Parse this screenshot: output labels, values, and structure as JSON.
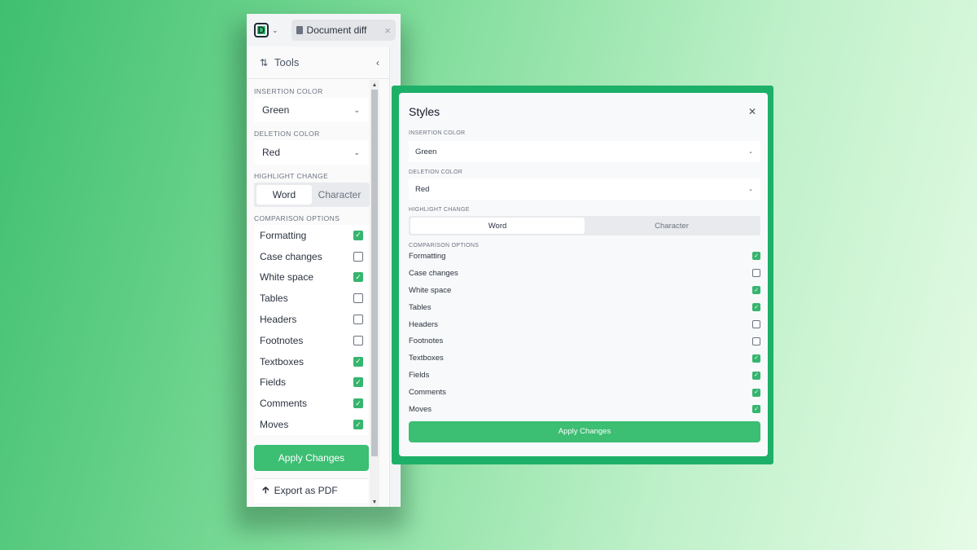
{
  "app": {
    "logo_letter": "D",
    "tab_title": "Document diff"
  },
  "tools": {
    "label": "Tools"
  },
  "insertion": {
    "label": "INSERTION COLOR",
    "value": "Green"
  },
  "deletion": {
    "label": "DELETION COLOR",
    "value": "Red"
  },
  "highlight": {
    "label": "HIGHLIGHT CHANGE",
    "options": [
      "Word",
      "Character"
    ],
    "selected": "Word"
  },
  "comparison": {
    "label": "COMPARISON OPTIONS",
    "items": [
      {
        "label": "Formatting",
        "checked": true
      },
      {
        "label": "Case changes",
        "checked": false
      },
      {
        "label": "White space",
        "checked": true
      },
      {
        "label": "Tables",
        "checked": false
      },
      {
        "label": "Headers",
        "checked": false
      },
      {
        "label": "Footnotes",
        "checked": false
      },
      {
        "label": "Textboxes",
        "checked": true
      },
      {
        "label": "Fields",
        "checked": true
      },
      {
        "label": "Comments",
        "checked": true
      },
      {
        "label": "Moves",
        "checked": true
      }
    ]
  },
  "dialog_comparison": {
    "items": [
      {
        "label": "Formatting",
        "checked": true
      },
      {
        "label": "Case changes",
        "checked": false
      },
      {
        "label": "White space",
        "checked": true
      },
      {
        "label": "Tables",
        "checked": true
      },
      {
        "label": "Headers",
        "checked": false
      },
      {
        "label": "Footnotes",
        "checked": false
      },
      {
        "label": "Textboxes",
        "checked": true
      },
      {
        "label": "Fields",
        "checked": true
      },
      {
        "label": "Comments",
        "checked": true
      },
      {
        "label": "Moves",
        "checked": true
      }
    ]
  },
  "apply_label": "Apply Changes",
  "export_label": "Export as PDF",
  "dialog": {
    "title": "Styles"
  },
  "colors": {
    "accent": "#3cbe73",
    "frame": "#1db068"
  }
}
